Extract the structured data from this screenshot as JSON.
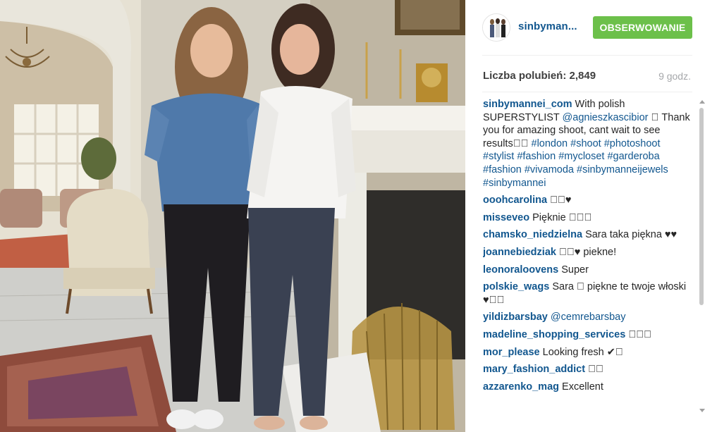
{
  "post": {
    "username": "sinbyman...",
    "follow_label": "OBSERWOWANIE",
    "likes_text": "Liczba polubień: 2,849",
    "time_text": "9 godz."
  },
  "caption": {
    "user": "sinbymannei_com",
    "text_1": "With polish SUPERSTYLIST ",
    "mention": "@agnieszkascibior",
    "text_2": " 󾌴 Thank you for amazing shoot, cant wait to see results󾌴󾌴 ",
    "hashtags": "#london #shoot #photoshoot #stylist #fashion #mycloset #garderoba #fashion #vivamoda #sinbymanneijewels #sinbymannei"
  },
  "comments": [
    {
      "user": "ooohcarolina",
      "text": "󾌴󾌴♥"
    },
    {
      "user": "misseveo",
      "text": "Pięknie 󾌴󾌴󾌴"
    },
    {
      "user": "chamsko_niedzielna",
      "text": "Sara taka piękna ♥♥"
    },
    {
      "user": "joannebiedziak",
      "text": "󾌴󾌴♥ piekne!"
    },
    {
      "user": "leonoraloovens",
      "text": "Super"
    },
    {
      "user": "polskie_wags",
      "text": "Sara 󾌴 piękne te twoje włoski ♥󾌴󾌴"
    },
    {
      "user": "yildizbarsbay",
      "text": "",
      "mention": "@cemrebarsbay"
    },
    {
      "user": "madeline_shopping_services",
      "text": "󾌴󾌴󾌴"
    },
    {
      "user": "mor_please",
      "text": "Looking fresh ✔󾌴"
    },
    {
      "user": "mary_fashion_addict",
      "text": "󾌴󾌴"
    },
    {
      "user": "azzarenko_mag",
      "text": "Excellent"
    }
  ],
  "colors": {
    "link": "#12578f",
    "follow_button": "#6cc04a",
    "muted": "#a5a7aa"
  },
  "icons": {
    "avatar": "profile-avatar-icon",
    "scroll_up": "scroll-up-arrow-icon",
    "scroll_down": "scroll-down-arrow-icon"
  }
}
